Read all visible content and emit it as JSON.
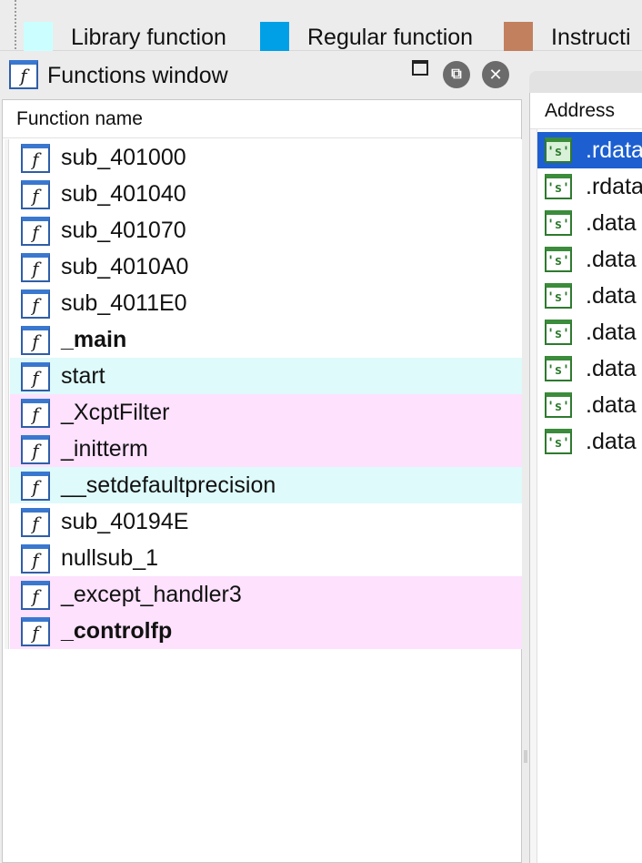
{
  "legend": {
    "items": [
      {
        "label": "Library function",
        "color": "#cbffff"
      },
      {
        "label": "Regular function",
        "color": "#00a0e6"
      },
      {
        "label": "Instructi",
        "color": "#c2805e"
      }
    ]
  },
  "functions_window": {
    "title": "Functions window",
    "column_header": "Function name",
    "icon": "function-f-icon",
    "row_colors": {
      "regular": "#ffffff",
      "library": "#defafa",
      "imported": "#fde1fd"
    },
    "rows": [
      {
        "name": "sub_401000",
        "kind": "regular",
        "bold": false
      },
      {
        "name": "sub_401040",
        "kind": "regular",
        "bold": false
      },
      {
        "name": "sub_401070",
        "kind": "regular",
        "bold": false
      },
      {
        "name": "sub_4010A0",
        "kind": "regular",
        "bold": false
      },
      {
        "name": "sub_4011E0",
        "kind": "regular",
        "bold": false
      },
      {
        "name": "_main",
        "kind": "regular",
        "bold": true
      },
      {
        "name": "start",
        "kind": "library",
        "bold": false
      },
      {
        "name": "_XcptFilter",
        "kind": "imported",
        "bold": false
      },
      {
        "name": "_initterm",
        "kind": "imported",
        "bold": false
      },
      {
        "name": "__setdefaultprecision",
        "kind": "library",
        "bold": false
      },
      {
        "name": "sub_40194E",
        "kind": "regular",
        "bold": false
      },
      {
        "name": "nullsub_1",
        "kind": "regular",
        "bold": false
      },
      {
        "name": "_except_handler3",
        "kind": "imported",
        "bold": false
      },
      {
        "name": "_controlfp",
        "kind": "imported",
        "bold": true
      }
    ]
  },
  "strings_pane": {
    "column_header": "Address",
    "icon": "string-s-icon",
    "rows": [
      {
        "address": ".rdata",
        "selected": true
      },
      {
        "address": ".rdata",
        "selected": false
      },
      {
        "address": ".data",
        "selected": false
      },
      {
        "address": ".data",
        "selected": false
      },
      {
        "address": ".data",
        "selected": false
      },
      {
        "address": ".data",
        "selected": false
      },
      {
        "address": ".data",
        "selected": false
      },
      {
        "address": ".data",
        "selected": false
      },
      {
        "address": ".data",
        "selected": false
      }
    ]
  }
}
